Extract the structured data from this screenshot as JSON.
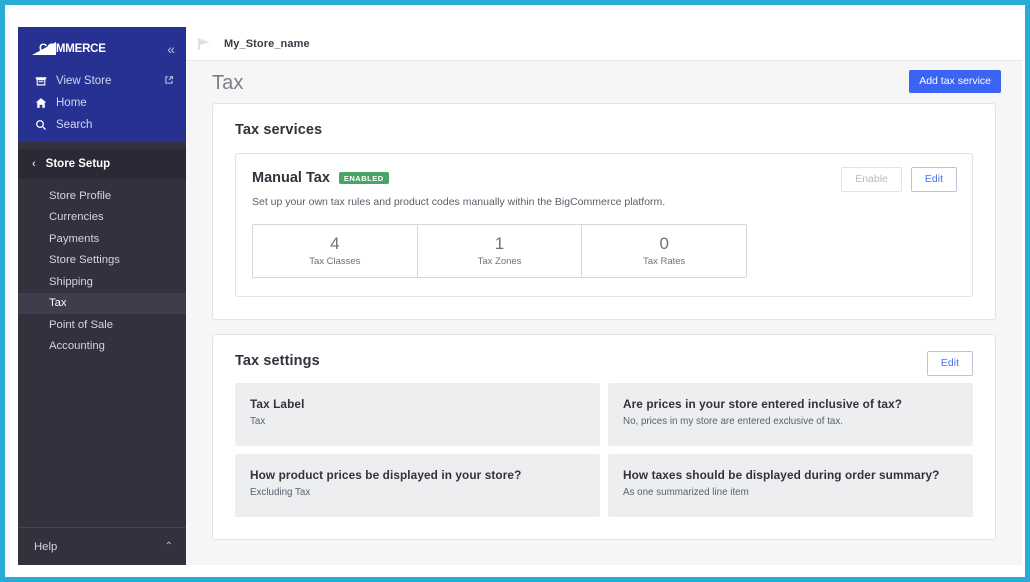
{
  "theme": {
    "frame_border": "#29ABD6",
    "sidebar_blue": "#273192",
    "sidebar_dark": "#34313f",
    "primary_button": "#3c64f4",
    "badge_green": "#4aa564",
    "link_blue": "#4c6ef5"
  },
  "sidebar": {
    "brand": "COMMERCE",
    "brand_mark": "bigcommerce-logo",
    "collapse_icon": "«",
    "links": [
      {
        "label": "View Store",
        "icon": "store-icon",
        "trailing_icon": "external-link-icon"
      },
      {
        "label": "Home",
        "icon": "home-icon",
        "trailing_icon": ""
      },
      {
        "label": "Search",
        "icon": "search-icon",
        "trailing_icon": ""
      }
    ],
    "section": {
      "label": "Store Setup",
      "chevron": "‹"
    },
    "items": [
      {
        "label": "Store Profile",
        "active": false
      },
      {
        "label": "Currencies",
        "active": false
      },
      {
        "label": "Payments",
        "active": false
      },
      {
        "label": "Store Settings",
        "active": false
      },
      {
        "label": "Shipping",
        "active": false
      },
      {
        "label": "Tax",
        "active": true
      },
      {
        "label": "Point of Sale",
        "active": false
      },
      {
        "label": "Accounting",
        "active": false
      }
    ],
    "footer": {
      "label": "Help",
      "chevron": "⌃"
    }
  },
  "topbar": {
    "store_icon": "store-flag-icon",
    "store_name": "My_Store_name"
  },
  "page": {
    "title": "Tax",
    "add_button": "Add tax service"
  },
  "tax_services": {
    "title": "Tax services",
    "service": {
      "name": "Manual Tax",
      "badge": "ENABLED",
      "description": "Set up your own tax rules and product codes manually within the BigCommerce platform.",
      "enable_button": "Enable",
      "edit_button": "Edit",
      "stats": [
        {
          "value": "4",
          "label": "Tax Classes"
        },
        {
          "value": "1",
          "label": "Tax Zones"
        },
        {
          "value": "0",
          "label": "Tax Rates"
        }
      ]
    }
  },
  "tax_settings": {
    "title": "Tax settings",
    "edit_button": "Edit",
    "items": [
      {
        "question": "Tax Label",
        "answer": "Tax"
      },
      {
        "question": "Are prices in your store entered inclusive of tax?",
        "answer": "No, prices in my store are entered exclusive of tax."
      },
      {
        "question": "How product prices be displayed in your store?",
        "answer": "Excluding Tax"
      },
      {
        "question": "How taxes should be displayed during order summary?",
        "answer": "As one summarized line item"
      }
    ]
  }
}
